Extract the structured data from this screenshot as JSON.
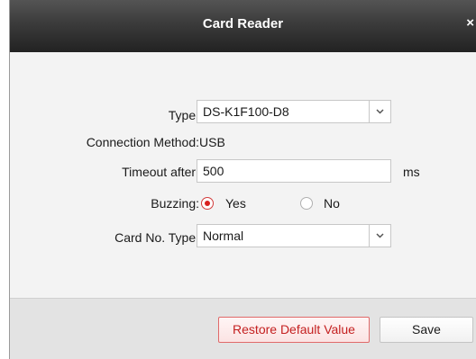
{
  "dialog": {
    "title": "Card Reader",
    "close_label": "×"
  },
  "form": {
    "type": {
      "label": "Type:",
      "selected": "DS-K1F100-D8"
    },
    "connection_method": {
      "label": "Connection Method:",
      "value": "USB"
    },
    "timeout": {
      "label": "Timeout after:",
      "value": "500",
      "unit": "ms"
    },
    "buzzing": {
      "label": "Buzzing:",
      "options": [
        "Yes",
        "No"
      ],
      "selected": "Yes"
    },
    "card_no_type": {
      "label": "Card No. Type:",
      "selected": "Normal"
    }
  },
  "footer": {
    "restore_label": "Restore Default Value",
    "save_label": "Save"
  },
  "colors": {
    "titlebar": "#222222",
    "accent_red": "#d8201f",
    "body_bg": "#f3f3f3",
    "footer_bg": "#e3e3e3"
  },
  "icons": {
    "close": "close-icon",
    "dropdown": "chevron-down-icon"
  }
}
